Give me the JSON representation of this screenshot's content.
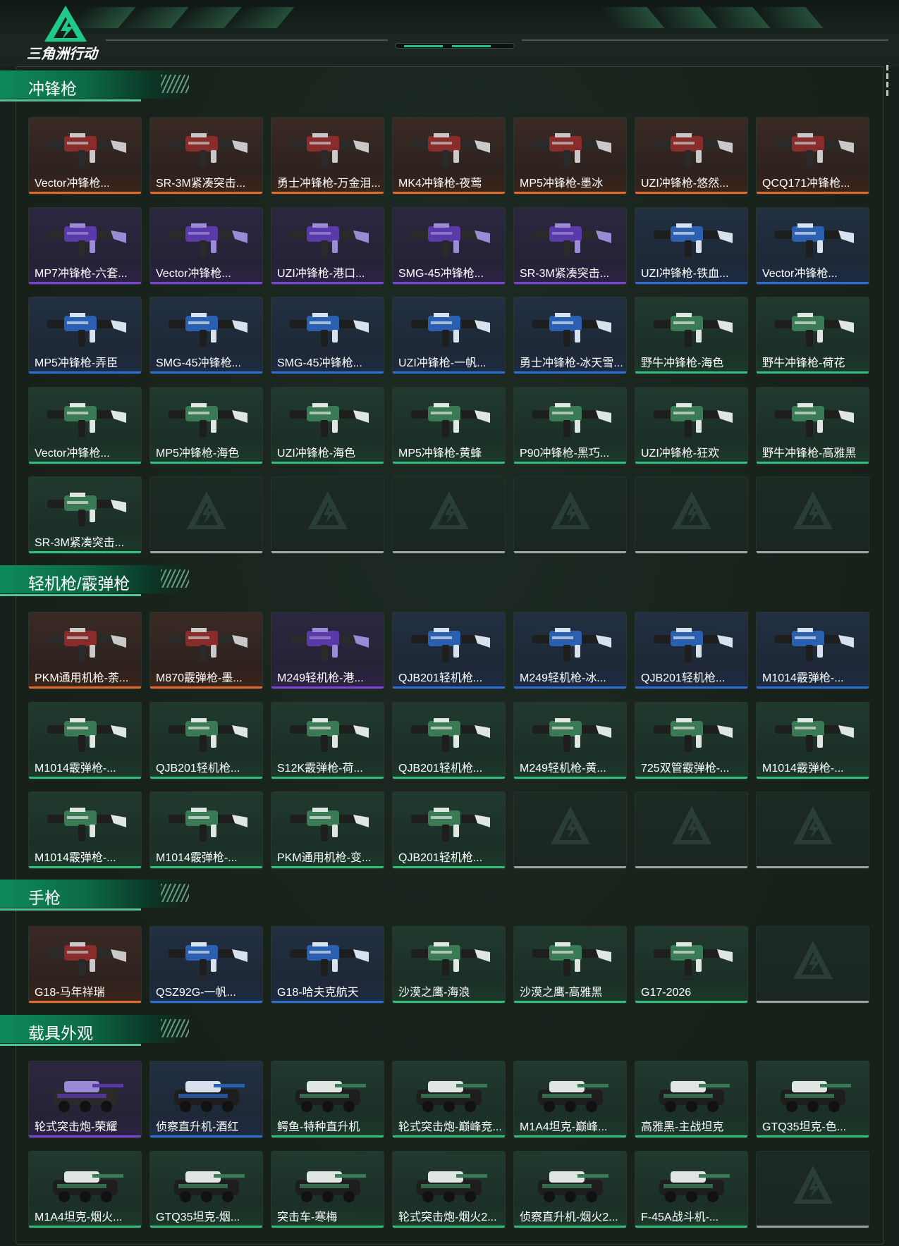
{
  "brand": {
    "name": "三角洲行动"
  },
  "colors": {
    "orange": "#e36a2a",
    "purple": "#7a44d6",
    "blue": "#2b6fd6",
    "green": "#2fbf7a",
    "gray": "#9aa39f"
  },
  "sections": [
    {
      "title": "冲锋枪",
      "items": [
        {
          "label": "Vector冲锋枪...",
          "rarity": "orange"
        },
        {
          "label": "SR-3M紧凑突击...",
          "rarity": "orange"
        },
        {
          "label": "勇士冲锋枪-万金泪...",
          "rarity": "orange"
        },
        {
          "label": "MK4冲锋枪-夜莺",
          "rarity": "orange"
        },
        {
          "label": "MP5冲锋枪-墨冰",
          "rarity": "orange"
        },
        {
          "label": "UZI冲锋枪-悠然...",
          "rarity": "orange"
        },
        {
          "label": "QCQ171冲锋枪...",
          "rarity": "orange"
        },
        {
          "label": "MP7冲锋枪-六套...",
          "rarity": "purple"
        },
        {
          "label": "Vector冲锋枪...",
          "rarity": "purple"
        },
        {
          "label": "UZI冲锋枪-港口...",
          "rarity": "purple"
        },
        {
          "label": "SMG-45冲锋枪...",
          "rarity": "purple"
        },
        {
          "label": "SR-3M紧凑突击...",
          "rarity": "purple"
        },
        {
          "label": "UZI冲锋枪-铁血...",
          "rarity": "blue"
        },
        {
          "label": "Vector冲锋枪...",
          "rarity": "blue"
        },
        {
          "label": "MP5冲锋枪-弄臣",
          "rarity": "blue"
        },
        {
          "label": "SMG-45冲锋枪...",
          "rarity": "blue"
        },
        {
          "label": "SMG-45冲锋枪...",
          "rarity": "blue"
        },
        {
          "label": "UZI冲锋枪-一帆...",
          "rarity": "blue"
        },
        {
          "label": "勇士冲锋枪-冰天雪...",
          "rarity": "blue"
        },
        {
          "label": "野牛冲锋枪-海色",
          "rarity": "green"
        },
        {
          "label": "野牛冲锋枪-荷花",
          "rarity": "green"
        },
        {
          "label": "Vector冲锋枪...",
          "rarity": "green"
        },
        {
          "label": "MP5冲锋枪-海色",
          "rarity": "green"
        },
        {
          "label": "UZI冲锋枪-海色",
          "rarity": "green"
        },
        {
          "label": "MP5冲锋枪-黄蜂",
          "rarity": "green"
        },
        {
          "label": "P90冲锋枪-黑巧...",
          "rarity": "green"
        },
        {
          "label": "UZI冲锋枪-狂欢",
          "rarity": "green"
        },
        {
          "label": "野牛冲锋枪-高雅黑",
          "rarity": "green"
        },
        {
          "label": "SR-3M紧凑突击...",
          "rarity": "green"
        },
        {
          "label": "",
          "rarity": "empty"
        },
        {
          "label": "",
          "rarity": "empty"
        },
        {
          "label": "",
          "rarity": "empty"
        },
        {
          "label": "",
          "rarity": "empty"
        },
        {
          "label": "",
          "rarity": "empty"
        },
        {
          "label": "",
          "rarity": "empty"
        }
      ]
    },
    {
      "title": "轻机枪/霰弹枪",
      "items": [
        {
          "label": "PKM通用机枪-荼...",
          "rarity": "orange"
        },
        {
          "label": "M870霰弹枪-墨...",
          "rarity": "orange"
        },
        {
          "label": "M249轻机枪-港...",
          "rarity": "purple"
        },
        {
          "label": "QJB201轻机枪...",
          "rarity": "blue"
        },
        {
          "label": "M249轻机枪-冰...",
          "rarity": "blue"
        },
        {
          "label": "QJB201轻机枪...",
          "rarity": "blue"
        },
        {
          "label": "M1014霰弹枪-...",
          "rarity": "blue"
        },
        {
          "label": "M1014霰弹枪-...",
          "rarity": "green"
        },
        {
          "label": "QJB201轻机枪...",
          "rarity": "green"
        },
        {
          "label": "S12K霰弹枪-荷...",
          "rarity": "green"
        },
        {
          "label": "QJB201轻机枪...",
          "rarity": "green"
        },
        {
          "label": "M249轻机枪-黄...",
          "rarity": "green"
        },
        {
          "label": "725双管霰弹枪-...",
          "rarity": "green"
        },
        {
          "label": "M1014霰弹枪-...",
          "rarity": "green"
        },
        {
          "label": "M1014霰弹枪-...",
          "rarity": "green"
        },
        {
          "label": "M1014霰弹枪-...",
          "rarity": "green"
        },
        {
          "label": "PKM通用机枪-变...",
          "rarity": "green"
        },
        {
          "label": "QJB201轻机枪...",
          "rarity": "green"
        },
        {
          "label": "",
          "rarity": "empty"
        },
        {
          "label": "",
          "rarity": "empty"
        },
        {
          "label": "",
          "rarity": "empty"
        }
      ]
    },
    {
      "title": "手枪",
      "items": [
        {
          "label": "G18-马年祥瑞",
          "rarity": "orange"
        },
        {
          "label": "QSZ92G-一帆...",
          "rarity": "blue"
        },
        {
          "label": "G18-哈夫克航天",
          "rarity": "blue"
        },
        {
          "label": "沙漠之鹰-海浪",
          "rarity": "green"
        },
        {
          "label": "沙漠之鹰-高雅黑",
          "rarity": "green"
        },
        {
          "label": "G17-2026",
          "rarity": "green"
        },
        {
          "label": "",
          "rarity": "empty"
        }
      ]
    },
    {
      "title": "载具外观",
      "items": [
        {
          "label": "轮式突击炮-荣耀",
          "rarity": "purple"
        },
        {
          "label": "侦察直升机-酒红",
          "rarity": "blue"
        },
        {
          "label": "鳄鱼-特种直升机",
          "rarity": "green"
        },
        {
          "label": "轮式突击炮-巅峰竞...",
          "rarity": "green"
        },
        {
          "label": "M1A4坦克-巅峰...",
          "rarity": "green"
        },
        {
          "label": "高雅黑-主战坦克",
          "rarity": "green"
        },
        {
          "label": "GTQ35坦克-色...",
          "rarity": "green"
        },
        {
          "label": "M1A4坦克-烟火...",
          "rarity": "green"
        },
        {
          "label": "GTQ35坦克-烟...",
          "rarity": "green"
        },
        {
          "label": "突击车-寒梅",
          "rarity": "green"
        },
        {
          "label": "轮式突击炮-烟火2...",
          "rarity": "green"
        },
        {
          "label": "侦察直升机-烟火2...",
          "rarity": "green"
        },
        {
          "label": "F-45A战斗机-...",
          "rarity": "green"
        },
        {
          "label": "",
          "rarity": "empty"
        }
      ]
    }
  ]
}
